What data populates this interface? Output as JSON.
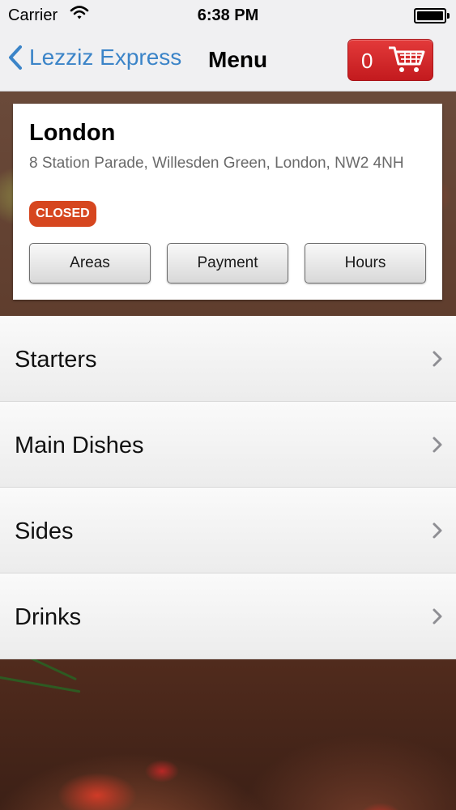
{
  "status_bar": {
    "carrier": "Carrier",
    "time": "6:38 PM"
  },
  "nav": {
    "back_label": "Lezziz Express",
    "title": "Menu",
    "cart_count": "0"
  },
  "store": {
    "city": "London",
    "address": "8 Station Parade, Willesden Green, London, NW2 4NH",
    "status": "CLOSED",
    "buttons": [
      "Areas",
      "Payment",
      "Hours"
    ]
  },
  "menu": {
    "items": [
      {
        "label": "Starters"
      },
      {
        "label": "Main Dishes"
      },
      {
        "label": "Sides"
      },
      {
        "label": "Drinks"
      }
    ]
  },
  "colors": {
    "accent": "#3b84c8",
    "cart_red": "#d42a2d",
    "closed_badge": "#d6461f"
  },
  "icons": [
    "wifi-icon",
    "battery-icon",
    "back-chevron-icon",
    "cart-icon",
    "chevron-right-icon"
  ]
}
